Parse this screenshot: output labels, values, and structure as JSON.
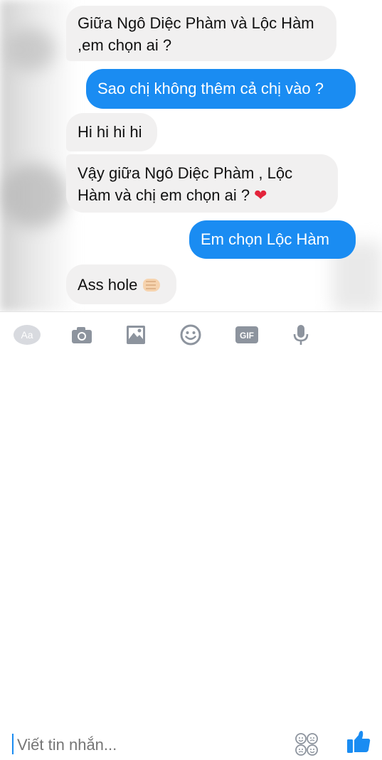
{
  "messages": [
    {
      "side": "in",
      "text": "Giữa Ngô Diệc Phàm và Lộc Hàm ,em chọn ai ?"
    },
    {
      "side": "out",
      "text": "Sao chị không thêm cả chị vào ?"
    },
    {
      "side": "in",
      "text": "Hi hi hi hi"
    },
    {
      "side": "in",
      "text": "Vậy giữa Ngô Diệc Phàm , Lộc Hàm và chị em chọn ai  ?",
      "emoji": "heart"
    },
    {
      "side": "out",
      "text": "Em chọn Lộc Hàm"
    },
    {
      "side": "in",
      "text": "Ass hole",
      "emoji": "fist"
    }
  ],
  "toolbar": {
    "aa_label": "Aa",
    "gif_label": "GIF",
    "icons": [
      "aa-icon",
      "camera-icon",
      "image-icon",
      "smiley-icon",
      "gif-icon",
      "microphone-icon"
    ]
  },
  "composer": {
    "placeholder": "Viết tin nhắn...",
    "sticker_icon": "sticker-faces-icon",
    "like_icon": "thumbs-up-icon"
  },
  "colors": {
    "outgoing": "#1a8cf2",
    "incoming": "#f1f0f0",
    "icon_gray": "#8d949e",
    "heart": "#e3243b"
  }
}
